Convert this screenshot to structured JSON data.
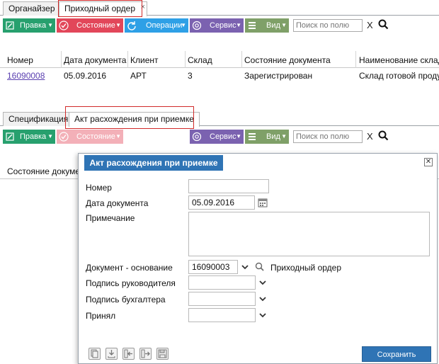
{
  "top_tabs": [
    {
      "label": "Органайзер"
    },
    {
      "label": "Приходный ордер",
      "close": "×"
    }
  ],
  "toolbar": {
    "edit": "Правка",
    "state": "Состояние",
    "operations": "Операции",
    "service": "Сервис",
    "view": "Вид",
    "search_placeholder": "Поиск по полю",
    "clear": "X"
  },
  "table": {
    "columns": [
      "Номер",
      "Дата документа",
      "Клиент",
      "Склад",
      "Состояние документа",
      "Наименование склада"
    ],
    "rows": [
      [
        "16090008",
        "05.09.2016",
        "АРТ",
        "3",
        "Зарегистрирован",
        "Склад готовой продукции"
      ]
    ]
  },
  "sub_tabs": [
    {
      "label": "Спецификация"
    },
    {
      "label": "Акт расхождения при приемке"
    }
  ],
  "sub_toolbar": {
    "edit": "Правка",
    "state": "Состояние",
    "service": "Сервис",
    "view": "Вид",
    "search_placeholder": "Поиск по полю",
    "clear": "X"
  },
  "sub_table": {
    "columns": [
      "Состояние документа"
    ]
  },
  "dialog": {
    "title": "Акт расхождения при приемке",
    "fields": {
      "number_label": "Номер",
      "number_value": "",
      "date_label": "Дата документа",
      "date_value": "05.09.2016",
      "note_label": "Примечание",
      "note_value": "",
      "base_doc_label": "Документ - основание",
      "base_doc_value": "16090003",
      "base_doc_type": "Приходный ордер",
      "manager_sign_label": "Подпись руководителя",
      "accountant_sign_label": "Подпись бухгалтера",
      "accepted_label": "Принял"
    },
    "save_label": "Сохранить"
  },
  "colors": {
    "accent_blue": "#2f74b5",
    "green": "#27a06e",
    "red": "#e2475a",
    "blue": "#2ea0e6",
    "purple": "#7b62b0",
    "olive": "#7fa068",
    "highlight_red": "#d12a2a"
  }
}
